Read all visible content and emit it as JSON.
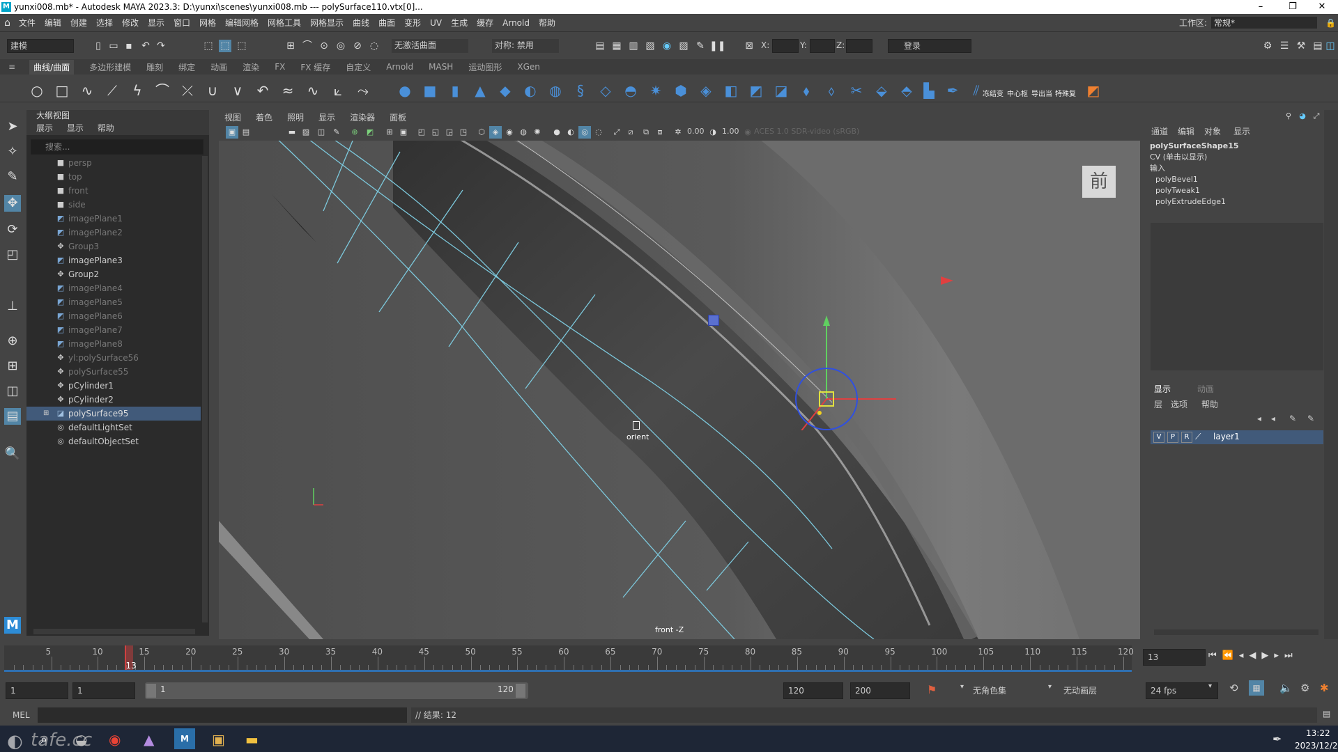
{
  "titlebar": {
    "title": "yunxi008.mb* - Autodesk MAYA 2023.3: D:\\yunxi\\scenes\\yunxi008.mb   ---   polySurface110.vtx[0]...",
    "min": "–",
    "max": "❐",
    "close": "✕"
  },
  "menubar": {
    "items": [
      "文件",
      "编辑",
      "创建",
      "选择",
      "修改",
      "显示",
      "窗口",
      "网格",
      "编辑网格",
      "网格工具",
      "网格显示",
      "曲线",
      "曲面",
      "变形",
      "UV",
      "生成",
      "缓存",
      "Arnold",
      "帮助"
    ]
  },
  "workspace": {
    "label": "工作区:",
    "value": "常规*"
  },
  "statusline": {
    "mode": "建模",
    "live_surface": "无激活曲面",
    "symmetry": "对称: 禁用",
    "x": "X:",
    "y": "Y:",
    "z": "Z:",
    "login": "登录"
  },
  "shelf": {
    "tabs": [
      "曲线/曲面",
      "多边形建模",
      "雕刻",
      "绑定",
      "动画",
      "渲染",
      "FX",
      "FX 缓存",
      "自定义",
      "Arnold",
      "MASH",
      "运动图形",
      "XGen"
    ],
    "labels": [
      "冻结变",
      "中心枢",
      "导出当",
      "特殊复"
    ]
  },
  "outliner": {
    "title": "大纲视图",
    "menu": [
      "展示",
      "显示",
      "帮助"
    ],
    "search_placeholder": "搜索...",
    "items": [
      {
        "label": "persp",
        "icon": "camera-icon",
        "dim": true,
        "sel": false
      },
      {
        "label": "top",
        "icon": "camera-icon",
        "dim": true,
        "sel": false
      },
      {
        "label": "front",
        "icon": "camera-icon",
        "dim": true,
        "sel": false
      },
      {
        "label": "side",
        "icon": "camera-icon",
        "dim": true,
        "sel": false
      },
      {
        "label": "imagePlane1",
        "icon": "imageplane-icon",
        "dim": true,
        "sel": false
      },
      {
        "label": "imagePlane2",
        "icon": "imageplane-icon",
        "dim": true,
        "sel": false
      },
      {
        "label": "Group3",
        "icon": "group-icon",
        "dim": true,
        "sel": false
      },
      {
        "label": "imagePlane3",
        "icon": "imageplane-icon",
        "dim": false,
        "sel": false
      },
      {
        "label": "Group2",
        "icon": "group-icon",
        "dim": false,
        "sel": false
      },
      {
        "label": "imagePlane4",
        "icon": "imageplane-icon",
        "dim": true,
        "sel": false
      },
      {
        "label": "imagePlane5",
        "icon": "imageplane-icon",
        "dim": true,
        "sel": false
      },
      {
        "label": "imagePlane6",
        "icon": "imageplane-icon",
        "dim": true,
        "sel": false
      },
      {
        "label": "imagePlane7",
        "icon": "imageplane-icon",
        "dim": true,
        "sel": false
      },
      {
        "label": "imagePlane8",
        "icon": "imageplane-icon",
        "dim": true,
        "sel": false
      },
      {
        "label": "yl:polySurface56",
        "icon": "group-icon",
        "dim": true,
        "sel": false
      },
      {
        "label": "polySurface55",
        "icon": "group-icon",
        "dim": true,
        "sel": false
      },
      {
        "label": "pCylinder1",
        "icon": "group-icon",
        "dim": false,
        "sel": false
      },
      {
        "label": "pCylinder2",
        "icon": "group-icon",
        "dim": false,
        "sel": false
      },
      {
        "label": "polySurface95",
        "icon": "mesh-icon",
        "dim": false,
        "sel": true
      },
      {
        "label": "defaultLightSet",
        "icon": "set-icon",
        "dim": false,
        "sel": false
      },
      {
        "label": "defaultObjectSet",
        "icon": "set-icon",
        "dim": false,
        "sel": false
      }
    ]
  },
  "viewport": {
    "menu": [
      "视图",
      "着色",
      "照明",
      "显示",
      "渲染器",
      "面板"
    ],
    "exposure": "0.00",
    "gamma": "1.00",
    "colorspace": "ACES 1.0 SDR-video (sRGB)",
    "camera_label": "front -Z",
    "viewcube_label": "前",
    "manipulator_label": "orient"
  },
  "channelbox": {
    "menu": [
      "通道",
      "编辑",
      "对象",
      "显示"
    ],
    "shape": "polySurfaceShape15",
    "cv": "CV (单击以显示)",
    "inputs_label": "输入",
    "inputs": [
      "polyBevel1",
      "polyTweak1",
      "polyExtrudeEdge1"
    ]
  },
  "layereditor": {
    "tabs": [
      "显示",
      "动画"
    ],
    "menu": [
      "层",
      "选项",
      "帮助"
    ],
    "layer": {
      "v": "V",
      "p": "P",
      "r": "R",
      "name": "layer1"
    }
  },
  "timeline": {
    "ticks": [
      "5",
      "10",
      "15",
      "20",
      "25",
      "30",
      "35",
      "40",
      "45",
      "50",
      "55",
      "60",
      "65",
      "70",
      "75",
      "80",
      "85",
      "90",
      "95",
      "100",
      "105",
      "110",
      "115",
      "120"
    ],
    "current": "13",
    "current_field": "13"
  },
  "range": {
    "start": "1",
    "anim_start": "1",
    "slider_start": "1",
    "slider_end": "120",
    "end": "120",
    "anim_end": "200",
    "charset": "无角色集",
    "animlayer": "无动画层",
    "fps": "24 fps"
  },
  "cmdline": {
    "lang": "MEL",
    "result": "// 结果: 12"
  },
  "taskbar": {
    "time": "13:22",
    "date": "2023/12/2"
  },
  "watermark": "tafe.cc"
}
